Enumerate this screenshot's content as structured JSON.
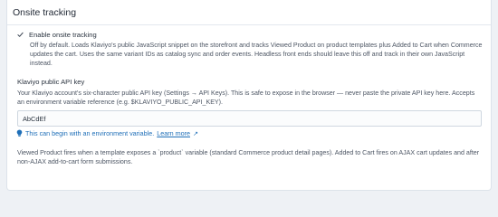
{
  "section": {
    "title": "Onsite tracking"
  },
  "tracking_checkbox": {
    "label": "Enable onsite tracking",
    "checked": true,
    "help": "Off by default. Loads Klaviyo's public JavaScript snippet on the storefront and tracks Viewed Product on product templates plus Added to Cart when Commerce updates the cart. Uses the same variant IDs as catalog sync and order events. Headless front ends should leave this off and track in their own JavaScript instead."
  },
  "api_key_field": {
    "label": "Klaviyo public API key",
    "help": "Your Klaviyo account's six-character public API key (Settings → API Keys). This is safe to expose in the browser — never paste the private API key here. Accepts an environment variable reference (e.g. $KLAVIYO_PUBLIC_API_KEY).",
    "value": "AbCdEf"
  },
  "env_hint": {
    "text": "This can begin with an environment variable.",
    "link_text": "Learn more",
    "link_suffix": "↗"
  },
  "footer": {
    "text": "Viewed Product fires when a template exposes a `product` variable (standard Commerce product detail pages). Added to Cart fires on AJAX cart updates and after non-AJAX add-to-cart form submissions."
  },
  "colors": {
    "accent": "#1f6fb8",
    "check": "#313b4a"
  },
  "icons": {
    "checkbox": "check-icon",
    "hint": "lightbulb-icon"
  }
}
